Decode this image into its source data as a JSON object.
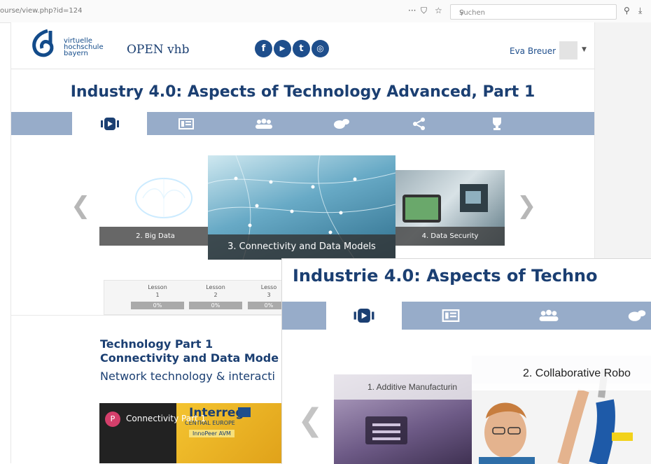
{
  "browser": {
    "url": "ourse/view.php?id=124",
    "search_placeholder": "Suchen"
  },
  "site": {
    "logo_lines": [
      "virtuelle",
      "hochschule",
      "bayern"
    ],
    "name": "OPEN vhb",
    "user": "Eva Breuer"
  },
  "social": [
    "f",
    "▶",
    "t",
    "◎"
  ],
  "course1": {
    "title": "Industry 4.0: Aspects of Technology Advanced, Part 1",
    "carousel": [
      "2. Big Data",
      "3. Connectivity and Data Models",
      "4. Data Security"
    ],
    "lessons": [
      {
        "label": "Lesson",
        "num": "1",
        "progress": "0%"
      },
      {
        "label": "Lesson",
        "num": "2",
        "progress": "0%"
      },
      {
        "label": "Lesso",
        "num": "3",
        "progress": "0%"
      }
    ],
    "section_title": "Technology Part 1",
    "section_subtitle": "Connectivity and Data Mode",
    "section_text": "Network technology & interacti",
    "video": {
      "channel_initial": "P",
      "title": "Connectivity Part 1",
      "overlay_brand": "Interreg",
      "overlay_sub": "CENTRAL EUROPE",
      "overlay_tag": "InnoPeer AVM"
    }
  },
  "course2": {
    "title": "Industrie 4.0: Aspects of Techno",
    "carousel": [
      "1. Additive Manufacturin",
      "2. Collaborative Robo"
    ]
  },
  "colors": {
    "brand": "#1b3f72",
    "tab_bar": "#97acc9",
    "social": "#1e4e8c"
  }
}
